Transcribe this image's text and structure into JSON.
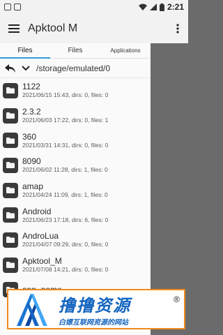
{
  "status_bar": {
    "time": "2:21",
    "left_icons": [
      "gallery-icon",
      "screenshot-icon"
    ],
    "right_icons": [
      "wifi-icon",
      "signal-icon",
      "battery-icon"
    ]
  },
  "app_bar": {
    "title": "Apktool M",
    "menu_icon": "hamburger-menu-icon",
    "more_icon": "more-vertical-icon"
  },
  "tabs": [
    {
      "label": "Files",
      "active": true
    },
    {
      "label": "Files",
      "active": false
    },
    {
      "label": "Applications",
      "active": false
    }
  ],
  "path_bar": {
    "path": "/storage/emulated/0",
    "back_icon": "back-arrow-icon",
    "expand_icon": "chevron-down-icon"
  },
  "files": [
    {
      "name": "1122",
      "meta": "2021/06/15 15:43, dirs: 0, files: 0"
    },
    {
      "name": "2.3.2",
      "meta": "2021/06/03 17:22, dirs: 0, files: 1"
    },
    {
      "name": "360",
      "meta": "2021/03/31 14:31, dirs: 0, files: 0"
    },
    {
      "name": "8090",
      "meta": "2021/06/02 11:28, dirs: 1, files: 0"
    },
    {
      "name": "amap",
      "meta": "2021/04/24 11:09, dirs: 1, files: 0"
    },
    {
      "name": "Android",
      "meta": "2021/06/23 17:18, dirs: 6, files: 0"
    },
    {
      "name": "AndroLua",
      "meta": "2021/04/07 09:29, dirs: 0, files: 0"
    },
    {
      "name": "Apktool_M",
      "meta": "2021/07/08 14:21, dirs: 0, files: 0"
    },
    {
      "name": "app_name",
      "meta": ""
    }
  ],
  "banner": {
    "title": "撸撸资源",
    "subtitle": "白嫖互联网资源的网站",
    "registered": "®",
    "accent_color": "#1565c0",
    "border_color": "#f08a1c"
  }
}
